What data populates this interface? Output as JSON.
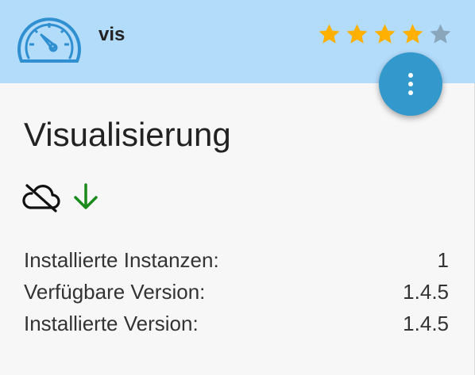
{
  "header": {
    "adapter_name": "vis",
    "logo_icon": "gauge-icon",
    "rating": 4,
    "rating_max": 5,
    "star_color": "#ffb000",
    "star_empty_color": "#8aa6bb",
    "background": "#b3dcfb"
  },
  "menu_button": {
    "icon": "more-vert-icon",
    "color": "#3399cc"
  },
  "card": {
    "title": "Visualisierung",
    "status_icons": [
      "cloud-off-icon",
      "arrow-down-icon"
    ],
    "arrow_color": "#1a8a1a"
  },
  "info": [
    {
      "label": "Installierte Instanzen:",
      "value": "1"
    },
    {
      "label": "Verfügbare Version:",
      "value": "1.4.5"
    },
    {
      "label": "Installierte Version:",
      "value": "1.4.5"
    }
  ]
}
